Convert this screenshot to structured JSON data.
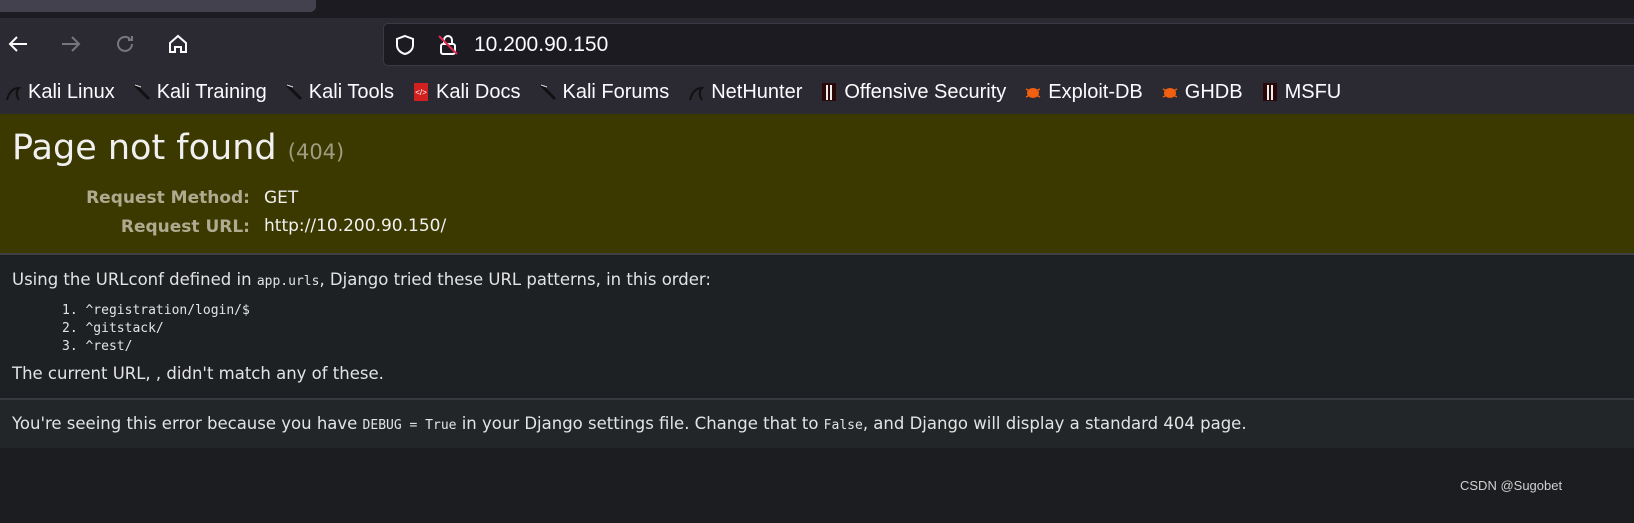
{
  "browser": {
    "url": "10.200.90.150",
    "bookmarks": [
      {
        "label": "Kali Linux",
        "icon": "kali-dragon-icon"
      },
      {
        "label": "Kali Training",
        "icon": "kali-icon"
      },
      {
        "label": "Kali Tools",
        "icon": "kali-icon"
      },
      {
        "label": "Kali Docs",
        "icon": "docs-icon"
      },
      {
        "label": "Kali Forums",
        "icon": "kali-icon"
      },
      {
        "label": "NetHunter",
        "icon": "kali-dragon-icon"
      },
      {
        "label": "Offensive Security",
        "icon": "offsec-icon"
      },
      {
        "label": "Exploit-DB",
        "icon": "exploit-db-icon"
      },
      {
        "label": "GHDB",
        "icon": "exploit-db-icon"
      },
      {
        "label": "MSFU",
        "icon": "offsec-icon"
      }
    ]
  },
  "page": {
    "title": "Page not found",
    "code": "(404)",
    "method_label": "Request Method:",
    "method": "GET",
    "url_label": "Request URL:",
    "request_url": "http://10.200.90.150/",
    "urlconf_pre": "Using the URLconf defined in ",
    "urlconf_module": "app.urls",
    "urlconf_post": ", Django tried these URL patterns, in this order:",
    "patterns": [
      "1. ^registration/login/$",
      "2. ^gitstack/",
      "3. ^rest/"
    ],
    "no_match": "The current URL, , didn't match any of these.",
    "debug_pre": "You're seeing this error because you have ",
    "debug_code": "DEBUG = True",
    "debug_mid": " in your Django settings file. Change that to ",
    "debug_false": "False",
    "debug_post": ", and Django will display a standard 404 page."
  },
  "watermark": "CSDN @Sugobet"
}
